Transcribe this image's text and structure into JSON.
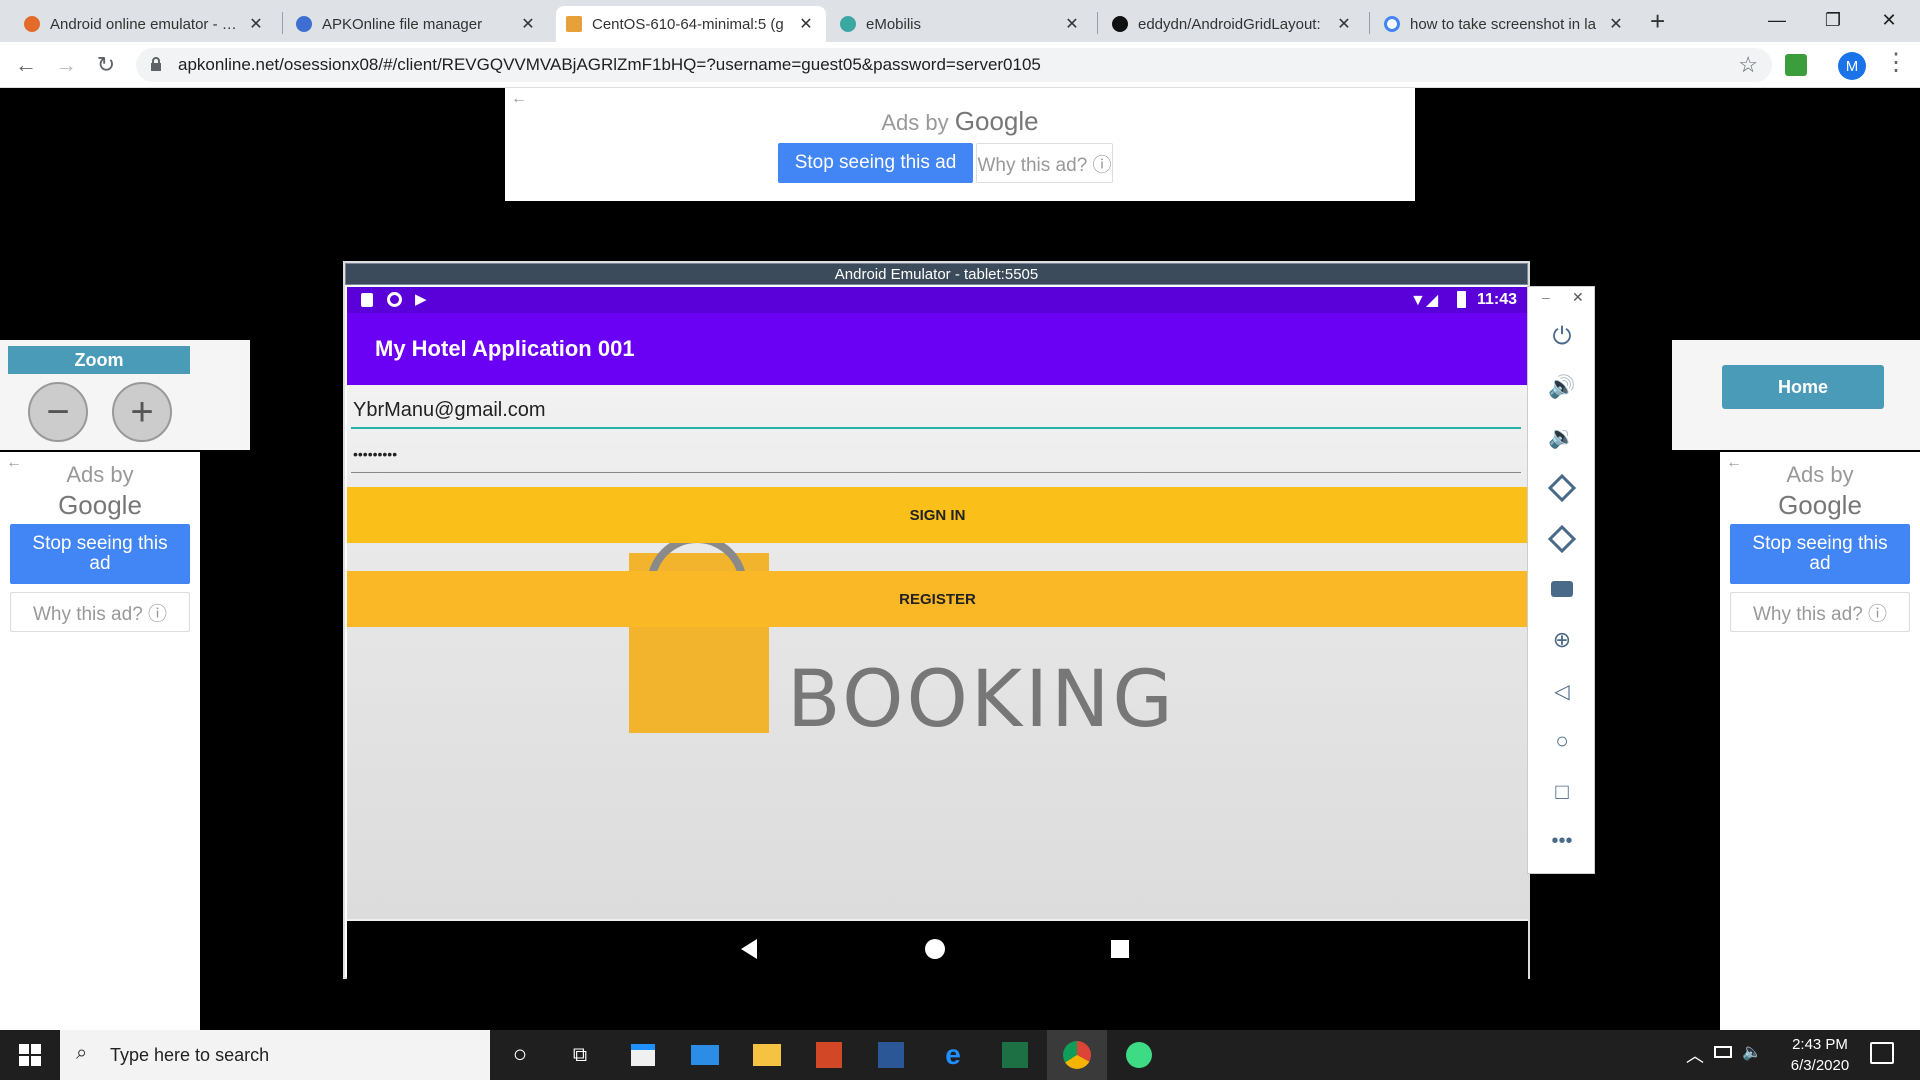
{
  "browser": {
    "tabs": [
      {
        "title": "Android online emulator - Ch",
        "favicon_color": "#e36b2c",
        "active": false
      },
      {
        "title": "APKOnline file manager",
        "favicon_color": "#3f6fd1",
        "active": false
      },
      {
        "title": "CentOS-610-64-minimal:5 (g",
        "favicon_color": "#e8a13a",
        "active": true
      },
      {
        "title": "eMobilis",
        "favicon_color": "#3aa7a0",
        "active": false
      },
      {
        "title": "eddydn/AndroidGridLayout:",
        "favicon_color": "#111111",
        "active": false
      },
      {
        "title": "how to take screenshot in la",
        "favicon_color": "#4285f4",
        "active": false
      }
    ],
    "new_tab": "+",
    "url": "apkonline.net/osessionx08/#/client/REVGQVVMVABjAGRlZmF1bHQ=?username=guest05&password=server0105",
    "profile_initial": "M"
  },
  "ads": {
    "top": {
      "ads_by": "Ads by",
      "google": "Google",
      "stop": "Stop seeing this ad",
      "why": "Why this ad? ⓘ"
    },
    "left": {
      "ads_by": "Ads by",
      "google": "Google",
      "stop": "Stop seeing this ad",
      "why": "Why this ad? ⓘ"
    },
    "right": {
      "ads_by": "Ads by",
      "google": "Google",
      "stop": "Stop seeing this ad",
      "why": "Why this ad? ⓘ"
    }
  },
  "zoom": {
    "title": "Zoom",
    "minus": "−",
    "plus": "+"
  },
  "home_button": "Home",
  "emulator": {
    "title": "Android Emulator - tablet:5505",
    "status": {
      "time": "11:43"
    },
    "app_title": "My Hotel Application 001",
    "email": "YbrManu@gmail.com",
    "password": "•••••••••",
    "sign_in": "SIGN IN",
    "register": "REGISTER",
    "logo_text": "BOOKING",
    "accent_color": "#6a00f4",
    "button_color": "#fbbf1a"
  },
  "taskbar": {
    "search_placeholder": "Type here to search",
    "time": "2:43 PM",
    "date": "6/3/2020"
  }
}
